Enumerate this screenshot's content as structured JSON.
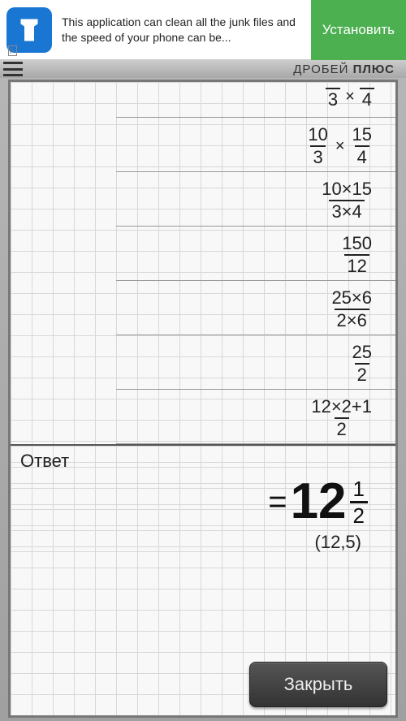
{
  "ad": {
    "text": "This application can clean all the junk files and the speed of your phone can be...",
    "button": "Установить",
    "tag": "▷"
  },
  "header": {
    "title_part1": "ДРОБЕЙ ",
    "title_part2": "ПЛЮС"
  },
  "steps": [
    {
      "type": "op",
      "left": {
        "num": "",
        "den": "3"
      },
      "operator": "×",
      "right": {
        "num": "",
        "den": "4"
      },
      "cutoff": true
    },
    {
      "type": "op",
      "left": {
        "num": "10",
        "den": "3"
      },
      "operator": "×",
      "right": {
        "num": "15",
        "den": "4"
      }
    },
    {
      "type": "single",
      "frac": {
        "num": "10×15",
        "den": "3×4"
      }
    },
    {
      "type": "single",
      "frac": {
        "num": "150",
        "den": "12"
      }
    },
    {
      "type": "single",
      "frac": {
        "num": "25×6",
        "den": "2×6"
      }
    },
    {
      "type": "single",
      "frac": {
        "num": "25",
        "den": "2"
      }
    },
    {
      "type": "single",
      "frac": {
        "num": "12×2+1",
        "den": "2"
      }
    }
  ],
  "answer": {
    "label": "Ответ",
    "eq": "=",
    "whole": "12",
    "frac_num": "1",
    "frac_den": "2",
    "decimal": "(12,5)"
  },
  "buttons": {
    "close": "Закрыть"
  }
}
